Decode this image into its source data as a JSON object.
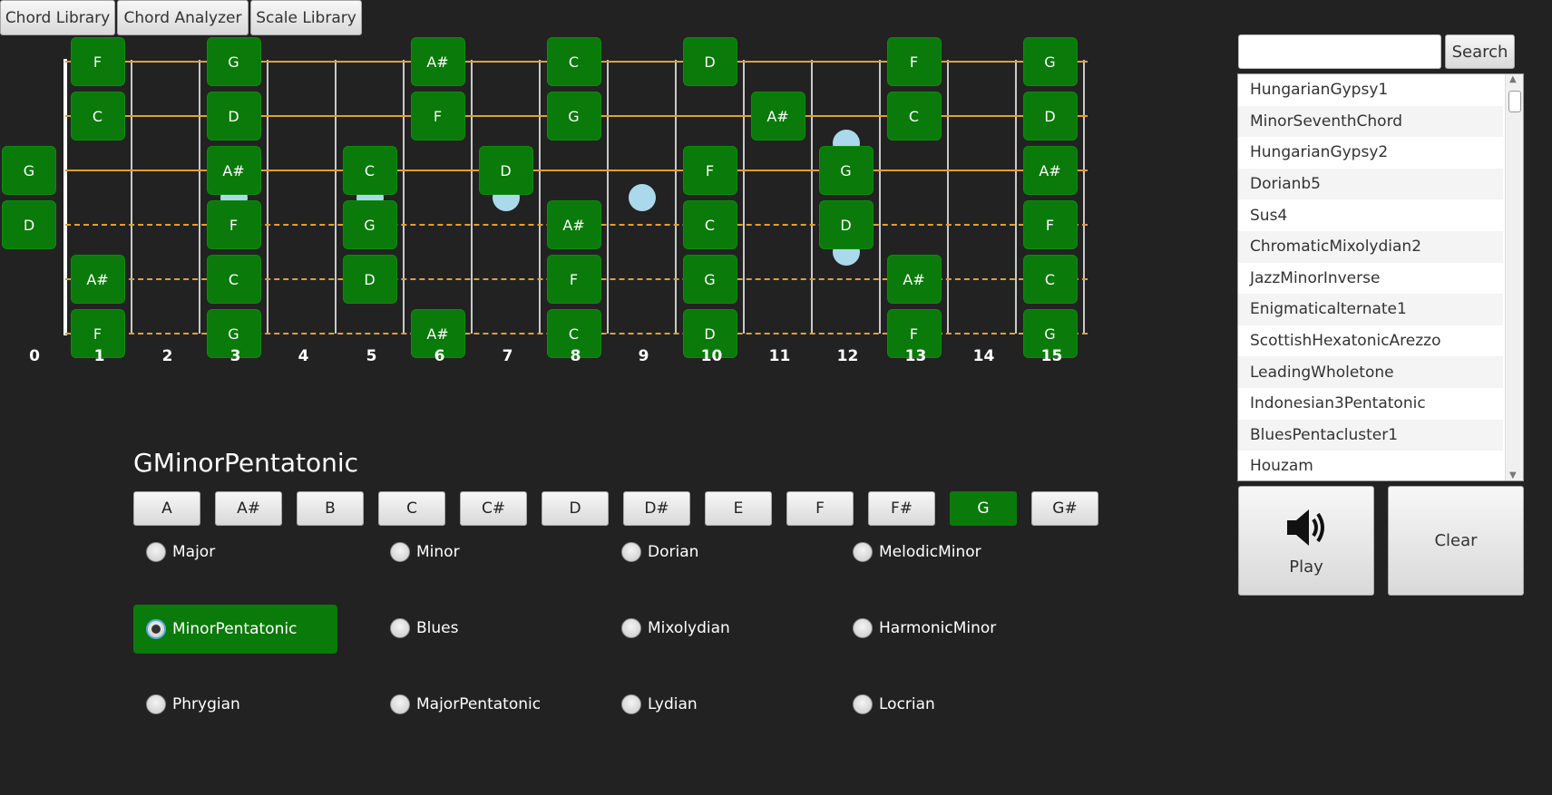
{
  "tabs": [
    "Chord Library",
    "Chord Analyzer",
    "Scale Library"
  ],
  "fretboard": {
    "fret_numbers": [
      "0",
      "1",
      "2",
      "3",
      "4",
      "5",
      "6",
      "7",
      "8",
      "9",
      "10",
      "11",
      "12",
      "13",
      "14",
      "15"
    ],
    "strings": [
      {
        "notes": [
          {
            "fret": 1,
            "note": "F"
          },
          {
            "fret": 3,
            "note": "G"
          },
          {
            "fret": 6,
            "note": "A#"
          },
          {
            "fret": 8,
            "note": "C"
          },
          {
            "fret": 10,
            "note": "D"
          },
          {
            "fret": 13,
            "note": "F"
          },
          {
            "fret": 15,
            "note": "G"
          }
        ]
      },
      {
        "notes": [
          {
            "fret": 1,
            "note": "C"
          },
          {
            "fret": 3,
            "note": "D"
          },
          {
            "fret": 6,
            "note": "F"
          },
          {
            "fret": 8,
            "note": "G"
          },
          {
            "fret": 11,
            "note": "A#"
          },
          {
            "fret": 13,
            "note": "C"
          },
          {
            "fret": 15,
            "note": "D"
          }
        ]
      },
      {
        "notes": [
          {
            "fret": 0,
            "note": "G"
          },
          {
            "fret": 3,
            "note": "A#"
          },
          {
            "fret": 5,
            "note": "C"
          },
          {
            "fret": 7,
            "note": "D"
          },
          {
            "fret": 10,
            "note": "F"
          },
          {
            "fret": 12,
            "note": "G"
          },
          {
            "fret": 15,
            "note": "A#"
          }
        ]
      },
      {
        "notes": [
          {
            "fret": 0,
            "note": "D"
          },
          {
            "fret": 3,
            "note": "F"
          },
          {
            "fret": 5,
            "note": "G"
          },
          {
            "fret": 8,
            "note": "A#"
          },
          {
            "fret": 10,
            "note": "C"
          },
          {
            "fret": 12,
            "note": "D"
          },
          {
            "fret": 15,
            "note": "F"
          }
        ]
      },
      {
        "notes": [
          {
            "fret": 1,
            "note": "A#"
          },
          {
            "fret": 3,
            "note": "C"
          },
          {
            "fret": 5,
            "note": "D"
          },
          {
            "fret": 8,
            "note": "F"
          },
          {
            "fret": 10,
            "note": "G"
          },
          {
            "fret": 13,
            "note": "A#"
          },
          {
            "fret": 15,
            "note": "C"
          }
        ]
      },
      {
        "notes": [
          {
            "fret": 1,
            "note": "F"
          },
          {
            "fret": 3,
            "note": "G"
          },
          {
            "fret": 6,
            "note": "A#"
          },
          {
            "fret": 8,
            "note": "C"
          },
          {
            "fret": 10,
            "note": "D"
          },
          {
            "fret": 13,
            "note": "F"
          },
          {
            "fret": 15,
            "note": "G"
          }
        ]
      }
    ],
    "string_color": "#e0a030",
    "note_color": "#0a7a0a",
    "inlay_color": "#a9d9ea"
  },
  "scale": {
    "title": "GMinorPentatonic",
    "roots": [
      "A",
      "A#",
      "B",
      "C",
      "C#",
      "D",
      "D#",
      "E",
      "F",
      "F#",
      "G",
      "G#"
    ],
    "selected_root": "G",
    "modes": [
      [
        "Major",
        "Minor",
        "Dorian",
        "MelodicMinor"
      ],
      [
        "MinorPentatonic",
        "Blues",
        "Mixolydian",
        "HarmonicMinor"
      ],
      [
        "Phrygian",
        "MajorPentatonic",
        "Lydian",
        "Locrian"
      ]
    ],
    "selected_mode": "MinorPentatonic"
  },
  "search": {
    "value": "",
    "button": "Search"
  },
  "scale_list": [
    "HungarianGypsy1",
    "MinorSeventhChord",
    "HungarianGypsy2",
    "Dorianb5",
    "Sus4",
    "ChromaticMixolydian2",
    "JazzMinorInverse",
    "Enigmaticalternate1",
    "ScottishHexatonicArezzo",
    "LeadingWholetone",
    "Indonesian3Pentatonic",
    "BluesPentacluster1",
    "Houzam"
  ],
  "play": {
    "label": "Play",
    "icon": "speaker-icon"
  },
  "clear": {
    "label": "Clear"
  }
}
